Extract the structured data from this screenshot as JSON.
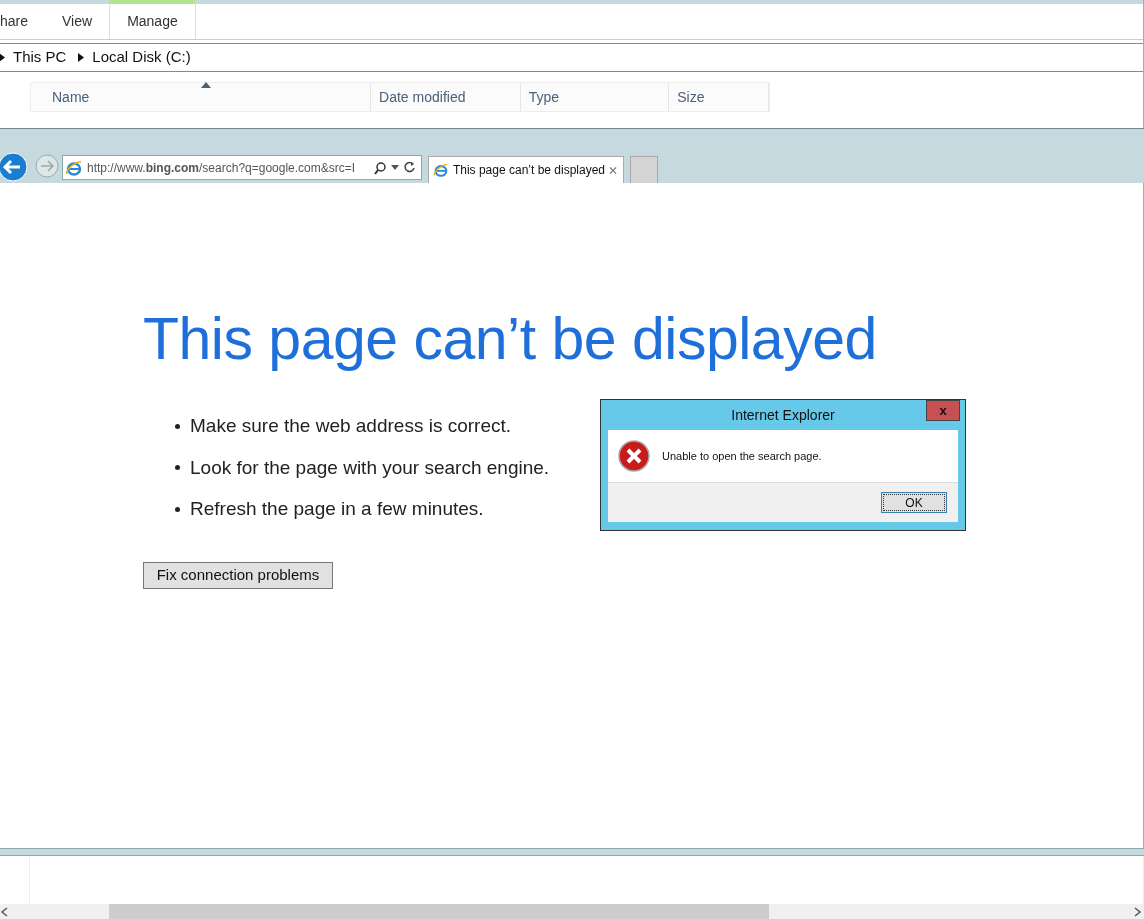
{
  "explorer": {
    "ribbon_tabs": [
      {
        "label": "hare",
        "selected": false
      },
      {
        "label": "View",
        "selected": false
      },
      {
        "label": "Manage",
        "selected": true
      }
    ],
    "breadcrumb": [
      "This PC",
      "Local Disk (C:)"
    ],
    "columns": [
      {
        "label": "Name",
        "sorted": true
      },
      {
        "label": "Date modified",
        "sorted": false
      },
      {
        "label": "Type",
        "sorted": false
      },
      {
        "label": "Size",
        "sorted": false
      }
    ]
  },
  "browser": {
    "address": "http://www.**bing.com**/search?q=google.com&src=I",
    "tabs": [
      {
        "label": "This page can’t be displayed",
        "selected": true
      }
    ],
    "page": {
      "heading": "This page can’t be displayed",
      "bullets": [
        "Make sure the web address is correct.",
        "Look for the page with your search engine.",
        "Refresh the page in a few minutes."
      ],
      "button": "Fix connection problems"
    }
  },
  "dialog": {
    "title": "Internet Explorer",
    "close": "x",
    "message": "Unable to open the search page.",
    "button": "OK"
  }
}
